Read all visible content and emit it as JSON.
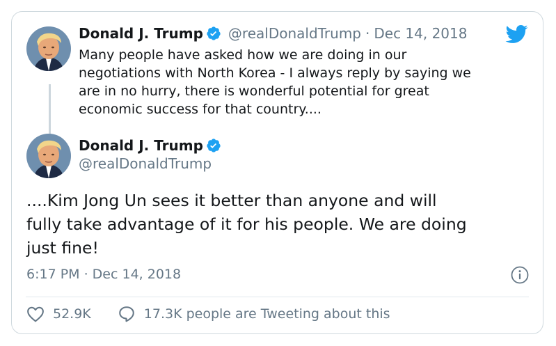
{
  "tweet1": {
    "author": {
      "name": "Donald J. Trump",
      "handle": "@realDonaldTrump",
      "avatar_icon": "avatar",
      "verified_icon": "verified-badge-icon"
    },
    "separator": "·",
    "date": "Dec 14, 2018",
    "lines": [
      "Many people have asked how we are doing in our",
      "negotiations with North Korea - I always reply by saying we",
      "are in no hurry, there is wonderful potential for great",
      "economic success for that country...."
    ]
  },
  "tweet2": {
    "author": {
      "name": "Donald J. Trump",
      "handle": "@realDonaldTrump"
    },
    "lines": [
      "....Kim Jong Un sees it better than anyone and will",
      "fully take advantage of it for his people. We are doing",
      "just fine!"
    ],
    "timestamp": "6:17 PM · Dec 14, 2018"
  },
  "actions": {
    "likes": "52.9K",
    "tweeting": "17.3K people are Tweeting about this"
  },
  "icons": {
    "brand": "twitter-bird-icon",
    "info": "info-icon",
    "like": "heart-icon",
    "reply": "speech-bubble-icon"
  },
  "colors": {
    "brand": "#1da1f2",
    "secondary_text": "#657786",
    "border": "#cfd9de"
  }
}
